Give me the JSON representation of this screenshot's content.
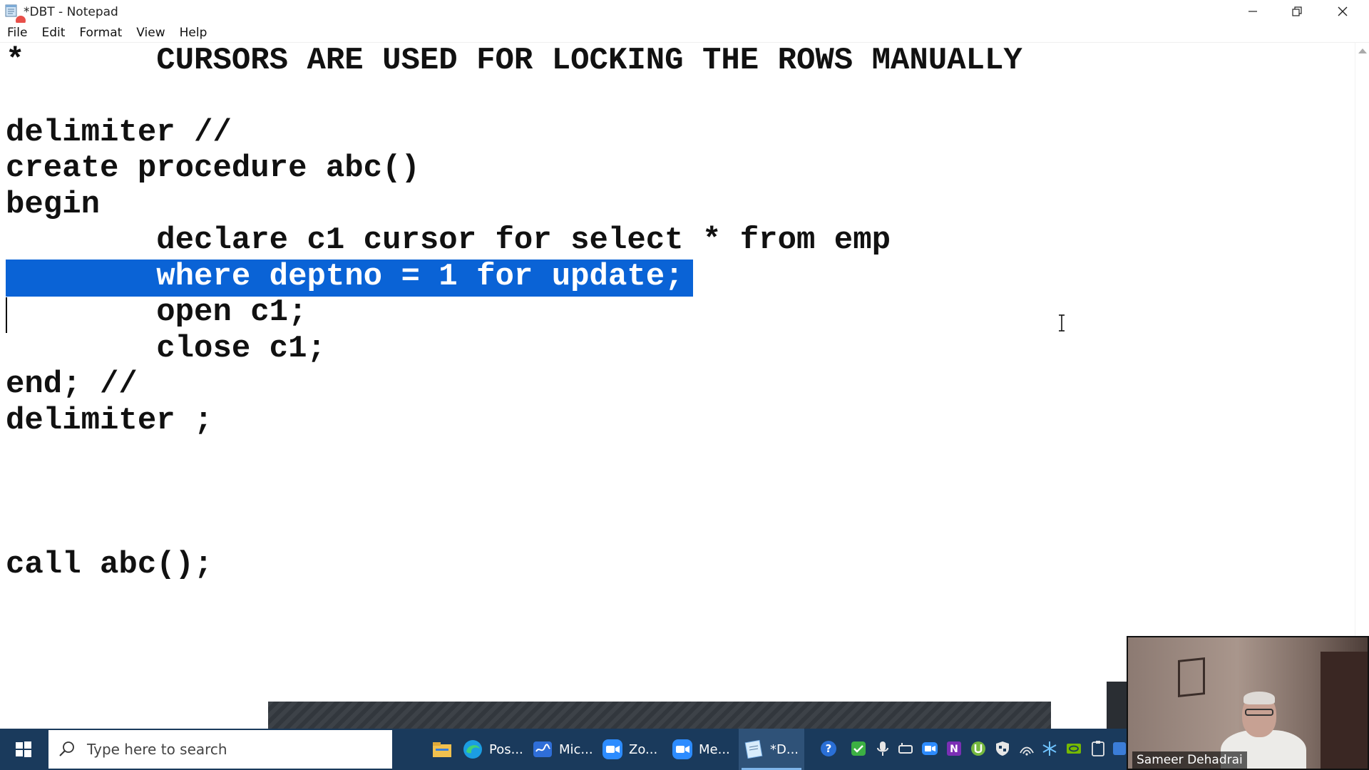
{
  "window": {
    "title": "*DBT - Notepad"
  },
  "menu": [
    "File",
    "Edit",
    "Format",
    "View",
    "Help"
  ],
  "editor": {
    "lines": [
      "*       CURSORS ARE USED FOR LOCKING THE ROWS MANUALLY",
      "",
      "delimiter //",
      "create procedure abc()",
      "begin",
      "        declare c1 cursor for select * from emp",
      "        where deptno = 1 for update;",
      "        open c1;",
      "        close c1;",
      "end; //",
      "delimiter ;",
      "",
      "",
      "",
      "call abc();"
    ],
    "selected_line_index": 6
  },
  "taskbar": {
    "search_placeholder": "Type here to search",
    "apps": [
      {
        "label": "",
        "icon": "file-explorer-icon"
      },
      {
        "label": "Pos...",
        "icon": "edge-icon"
      },
      {
        "label": "Mic...",
        "icon": "whiteboard-icon"
      },
      {
        "label": "Zo...",
        "icon": "zoom-icon"
      },
      {
        "label": "Me...",
        "icon": "zoom-meeting-icon"
      },
      {
        "label": "*D...",
        "icon": "notepad-icon"
      }
    ]
  },
  "webcam": {
    "name": "Sameer Dehadrai"
  },
  "colors": {
    "selection": "#0a63d6",
    "taskbar": "#1a3a5c"
  }
}
